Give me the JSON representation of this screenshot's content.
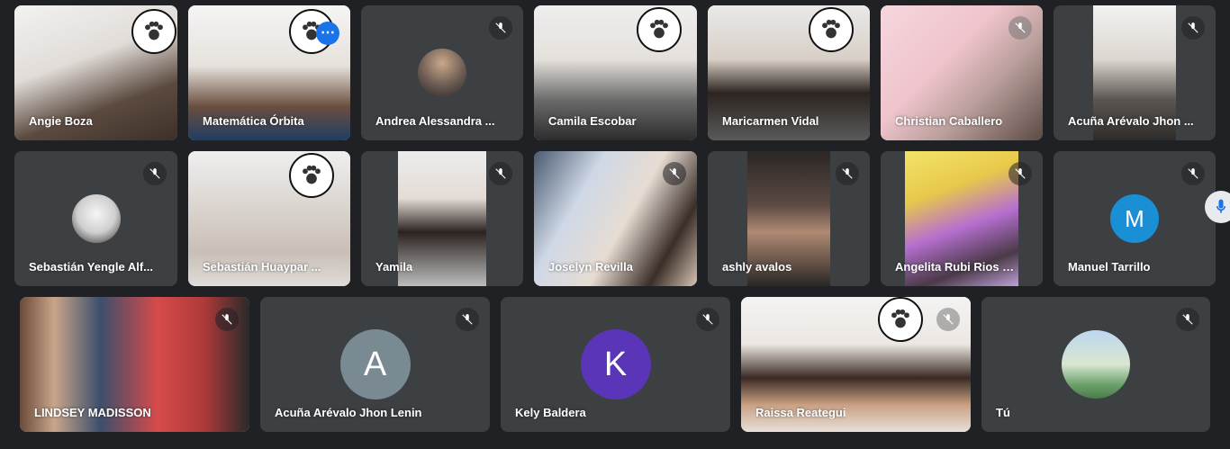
{
  "participants_row1": [
    {
      "name": "Angie Boza"
    },
    {
      "name": "Matemática Órbita"
    },
    {
      "name": "Andrea Alessandra ..."
    },
    {
      "name": "Camila Escobar"
    },
    {
      "name": "Maricarmen Vidal"
    },
    {
      "name": "Christian Caballero"
    },
    {
      "name": "Acuña Arévalo Jhon ..."
    }
  ],
  "participants_row2": [
    {
      "name": "Sebastián Yengle Alf..."
    },
    {
      "name": "Sebastián Huaypar ..."
    },
    {
      "name": "Yamila"
    },
    {
      "name": "Joselyn Revilla"
    },
    {
      "name": "ashly avalos"
    },
    {
      "name": "Angelita Rubi Rios Fi..."
    },
    {
      "name": "Manuel Tarrillo",
      "initial": "M",
      "color": "#1a8fd6"
    }
  ],
  "participants_row3": [
    {
      "name": "LINDSEY MADISSON"
    },
    {
      "name": "Acuña Arévalo Jhon Lenin",
      "initial": "A",
      "color": "#7a8a92"
    },
    {
      "name": "Kely Baldera",
      "initial": "K",
      "color": "#5b35b8"
    },
    {
      "name": "Raissa Reategui"
    },
    {
      "name": "Tú"
    }
  ],
  "icons": {
    "mic_off": "mic-off-icon",
    "more": "more-options-icon",
    "paw": "paw-badge-icon"
  }
}
